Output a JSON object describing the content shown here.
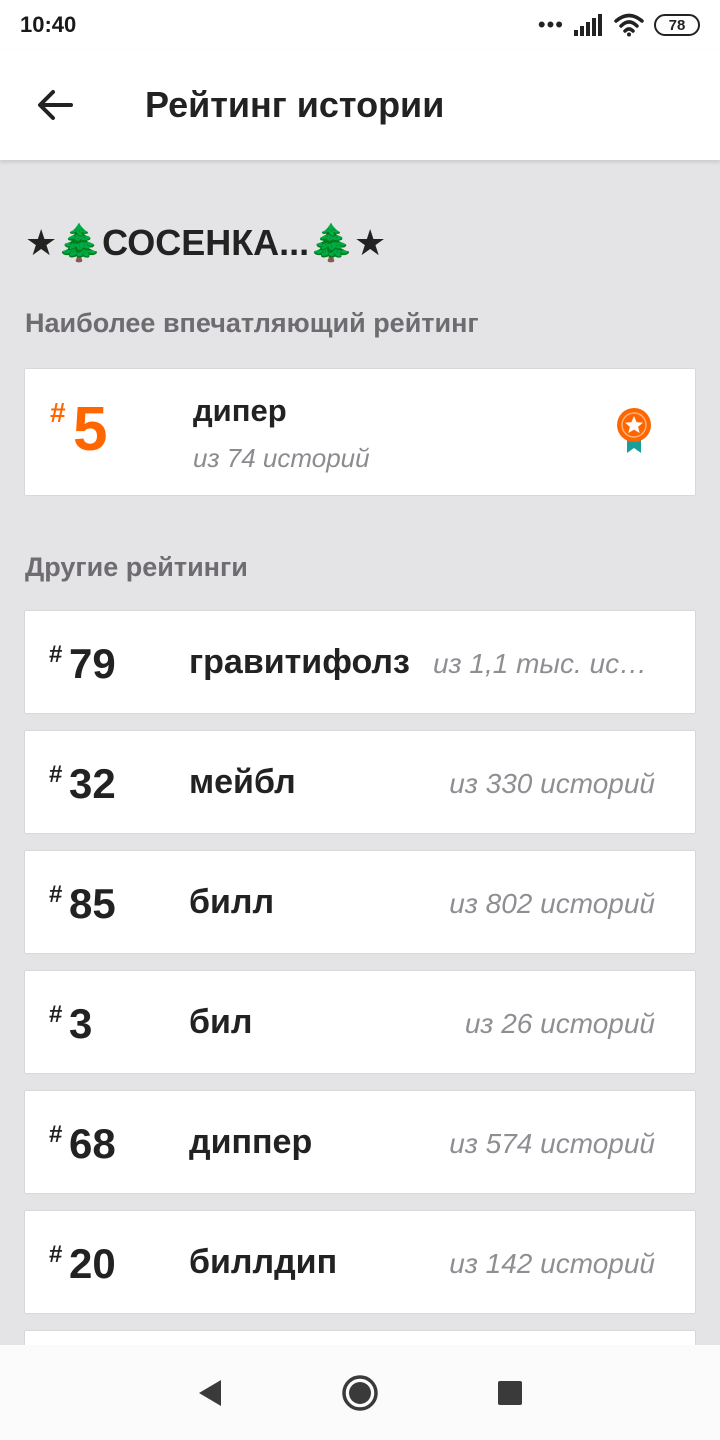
{
  "status_bar": {
    "time": "10:40",
    "dots": "•••",
    "battery": "78"
  },
  "app_bar": {
    "title": "Рейтинг истории",
    "back_icon": "arrow-left-icon"
  },
  "story": {
    "title": "★🌲СОСЕНКА...🌲★"
  },
  "best_section": {
    "label": "Наиболее впечатляющий рейтинг",
    "hash": "#",
    "rank": "5",
    "tag": "дипер",
    "subtitle": "из 74 историй",
    "badge_icon": "award-medal-icon",
    "accent_color": "#ff6600",
    "ribbon_color": "#1a9e9a"
  },
  "other_section": {
    "label": "Другие рейтинги",
    "items": [
      {
        "hash": "#",
        "rank": "79",
        "tag": "гравитифолз",
        "subtitle": "из 1,1 тыс. историй"
      },
      {
        "hash": "#",
        "rank": "32",
        "tag": "мейбл",
        "subtitle": "из 330 историй"
      },
      {
        "hash": "#",
        "rank": "85",
        "tag": "билл",
        "subtitle": "из 802 историй"
      },
      {
        "hash": "#",
        "rank": "3",
        "tag": "бил",
        "subtitle": "из 26 историй"
      },
      {
        "hash": "#",
        "rank": "68",
        "tag": "диппер",
        "subtitle": "из 574 историй"
      },
      {
        "hash": "#",
        "rank": "20",
        "tag": "биллдип",
        "subtitle": "из 142 историй"
      }
    ]
  },
  "nav_bar": {
    "back_icon": "triangle-back-icon",
    "home_icon": "circle-home-icon",
    "recents_icon": "square-recents-icon"
  }
}
